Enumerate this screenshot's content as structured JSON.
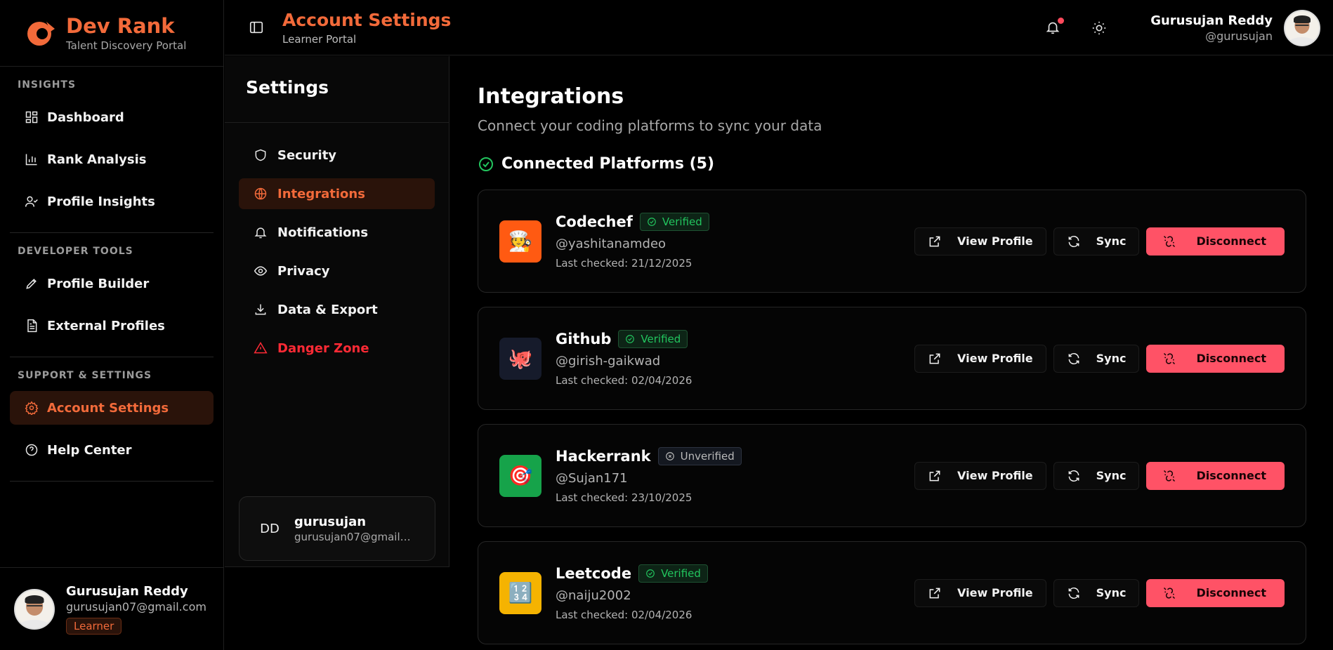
{
  "brand": {
    "name": "Dev Rank",
    "subtitle": "Talent Discovery Portal",
    "accent": "#f26a3a"
  },
  "sidebar": {
    "sections": [
      {
        "title": "INSIGHTS",
        "items": [
          {
            "label": "Dashboard",
            "icon": "dashboard-icon"
          },
          {
            "label": "Rank Analysis",
            "icon": "bar-chart-icon"
          },
          {
            "label": "Profile Insights",
            "icon": "user-check-icon"
          }
        ]
      },
      {
        "title": "DEVELOPER TOOLS",
        "items": [
          {
            "label": "Profile Builder",
            "icon": "pen-icon"
          },
          {
            "label": "External Profiles",
            "icon": "document-icon"
          }
        ]
      },
      {
        "title": "SUPPORT & SETTINGS",
        "items": [
          {
            "label": "Account Settings",
            "icon": "gear-icon",
            "active": true
          },
          {
            "label": "Help Center",
            "icon": "help-circle-icon"
          }
        ]
      }
    ],
    "user": {
      "name": "Gurusujan Reddy",
      "email": "gurusujan07@gmail.com",
      "role": "Learner"
    }
  },
  "topbar": {
    "title": "Account Settings",
    "subtitle": "Learner Portal",
    "user": {
      "name": "Gurusujan Reddy",
      "handle": "@gurusujan"
    }
  },
  "settings": {
    "title": "Settings",
    "menu": [
      {
        "label": "Security",
        "icon": "shield-icon"
      },
      {
        "label": "Integrations",
        "icon": "globe-icon",
        "active": true
      },
      {
        "label": "Notifications",
        "icon": "bell-icon"
      },
      {
        "label": "Privacy",
        "icon": "eye-icon"
      },
      {
        "label": "Data & Export",
        "icon": "download-icon"
      },
      {
        "label": "Danger Zone",
        "icon": "warning-icon",
        "danger": true
      }
    ],
    "user": {
      "initials": "DD",
      "name": "gurusujan",
      "email": "gurusujan07@gmail.com"
    }
  },
  "main": {
    "title": "Integrations",
    "subtitle": "Connect your coding platforms to sync your data",
    "connected_heading": "Connected Platforms (5)",
    "buttons": {
      "view_profile": "View Profile",
      "sync": "Sync",
      "disconnect": "Disconnect"
    },
    "platforms": [
      {
        "name": "Codechef",
        "status": "Verified",
        "handle": "@yashitanamdeo",
        "last_checked": "Last checked: 21/12/2025",
        "icon_glyph": "🧑‍🍳",
        "icon_bg": "#ff5a12"
      },
      {
        "name": "Github",
        "status": "Verified",
        "handle": "@girish-gaikwad",
        "last_checked": "Last checked: 02/04/2026",
        "icon_glyph": "🐙",
        "icon_bg": "#161b2b"
      },
      {
        "name": "Hackerrank",
        "status": "Unverified",
        "handle": "@Sujan171",
        "last_checked": "Last checked: 23/10/2025",
        "icon_glyph": "🎯",
        "icon_bg": "#16a34a"
      },
      {
        "name": "Leetcode",
        "status": "Verified",
        "handle": "@naiju2002",
        "last_checked": "Last checked: 02/04/2026",
        "icon_glyph": "🔢",
        "icon_bg": "#f5b301"
      }
    ]
  }
}
